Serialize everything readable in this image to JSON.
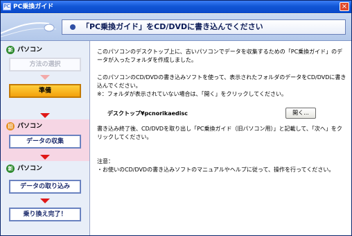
{
  "window": {
    "title": "PC乗換ガイド",
    "close_glyph": "×"
  },
  "banner": {
    "title": "「PC乗換ガイド」をCD/DVDに書き込んでください"
  },
  "sidebar": {
    "new_pc_section": {
      "badge": "新",
      "label": "パソコン"
    },
    "old_pc_section": {
      "badge": "旧",
      "label": "パソコン"
    },
    "new_pc_section2": {
      "badge": "新",
      "label": "パソコン"
    },
    "steps": {
      "method_selection": "方法の選択",
      "preparation": "準備",
      "data_collection": "データの収集",
      "data_import": "データの取り込み",
      "complete": "乗り換え完了！"
    }
  },
  "content": {
    "para1": "このパソコンのデスクトップ上に、古いパソコンでデータを収集するための「PC乗換ガイド」のデータが入ったフォルダを作成しました。",
    "para2": "このパソコンのCD/DVDの書き込みソフトを使って、表示されたフォルダのデータをCD/DVDに書き込んでください。",
    "note_folder": "※：フォルダが表示されていない場合は、「開く」をクリックしてください。",
    "folder_path": "デスクトップ¥pcnorikaedisc",
    "open_button": "開く...",
    "para3": "書き込み終了後、CD/DVDを取り出し「PC乗換ガイド（旧パソコン用）」と記載して、「次へ」をクリックしてください。",
    "note_title": "注意：",
    "note_body": "・お使いのCD/DVDの書き込みソフトのマニュアルやヘルプに従って、操作を行ってください。"
  }
}
